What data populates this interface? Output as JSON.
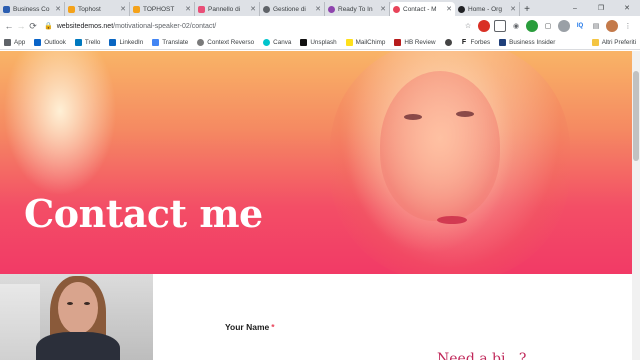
{
  "tabs": [
    {
      "label": "Business Co",
      "color": "#2a5db0",
      "glyph": "B",
      "active": false
    },
    {
      "label": "Tophost",
      "color": "#f4a21a",
      "glyph": "",
      "active": false
    },
    {
      "label": "TOPHOST",
      "color": "#f4a21a",
      "glyph": "",
      "active": false
    },
    {
      "label": "Pannello di",
      "color": "#e94e77",
      "glyph": "",
      "active": false
    },
    {
      "label": "Gestione di",
      "color": "#5f6368",
      "glyph": "",
      "active": false
    },
    {
      "label": "Ready To In",
      "color": "#8e44ad",
      "glyph": "",
      "active": false
    },
    {
      "label": "Contact - M",
      "color": "#e8445a",
      "glyph": "",
      "active": true
    },
    {
      "label": "Home - Org",
      "color": "#202124",
      "glyph": "",
      "active": false
    }
  ],
  "new_tab": "+",
  "window_controls": {
    "minimize": "–",
    "maximize": "❐",
    "close": "✕"
  },
  "nav": {
    "back": "←",
    "forward": "→",
    "reload": "⟳"
  },
  "address": {
    "domain": "websitedemos.net",
    "path": "/motivational-speaker-02/contact/"
  },
  "bookmarks": [
    {
      "label": "App",
      "color": "#5f6368"
    },
    {
      "label": "Outlook",
      "color": "#0a64c8"
    },
    {
      "label": "Trello",
      "color": "#0079bf"
    },
    {
      "label": "LinkedIn",
      "color": "#0a66c2"
    },
    {
      "label": "Translate",
      "color": "#4285f4"
    },
    {
      "label": "Context Reverso",
      "color": "#7a7a7a"
    },
    {
      "label": "Canva",
      "color": "#00c4cc"
    },
    {
      "label": "Unsplash",
      "color": "#111111"
    },
    {
      "label": "MailChimp",
      "color": "#ffe01b"
    },
    {
      "label": "HB Review",
      "color": "#b71c1c"
    },
    {
      "label": "",
      "color": "#444444"
    },
    {
      "label": "Forbes",
      "color": "#111111"
    },
    {
      "label": "Business Insider",
      "color": "#1f3f7a"
    }
  ],
  "bookmarks_other": "Altri Preferiti",
  "hero": {
    "title": "Contact me"
  },
  "form": {
    "name_label": "Your Name",
    "required_mark": "*"
  },
  "cut_heading": "Need a bi...?"
}
